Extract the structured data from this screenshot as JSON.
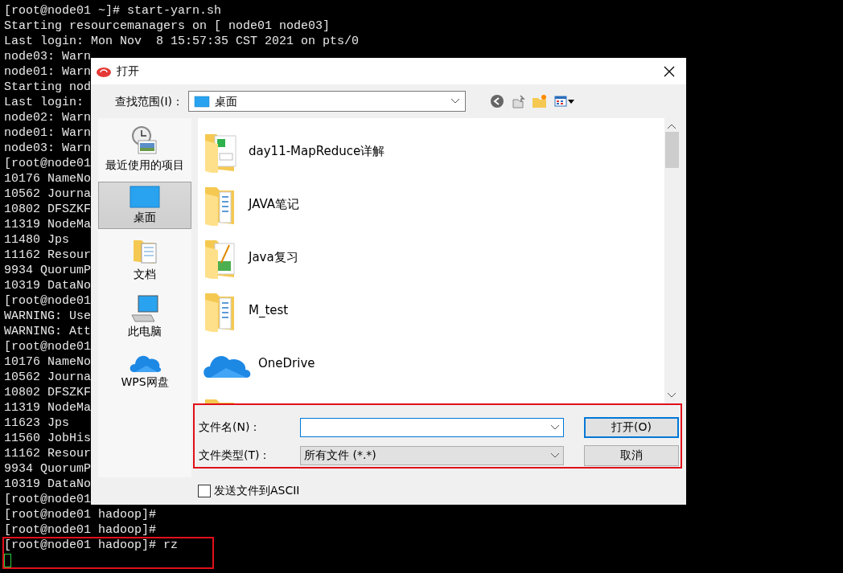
{
  "terminal": {
    "lines": [
      "[root@node01 ~]# start-yarn.sh",
      "Starting resourcemanagers on [ node01 node03]",
      "Last login: Mon Nov  8 15:57:35 CST 2021 on pts/0",
      "node03: Warn",
      "node01: Warn",
      "Starting nod",
      "Last login:",
      "node02: Warn",
      "node01: Warn",
      "node03: Warn",
      "[root@node01",
      "10176 NameNo",
      "10562 Journa",
      "10802 DFSZKF",
      "11319 NodeMa",
      "11480 Jps",
      "11162 Resour",
      "9934 QuorumP",
      "10319 DataNo",
      "[root@node01",
      "WARNING: Use",
      "WARNING: Att",
      "[root@node01",
      "10176 NameNo",
      "10562 Journa",
      "10802 DFSZKF",
      "11319 NodeMa",
      "11623 Jps",
      "11560 JobHis",
      "11162 Resour",
      "9934 QuorumP",
      "10319 DataNo",
      "[root@node01",
      "[root@node01 hadoop]#",
      "[root@node01 hadoop]#",
      "[root@node01 hadoop]# rz"
    ]
  },
  "dialog": {
    "title": "打开",
    "look_in": {
      "label": "查找范围(I)：",
      "value": "桌面"
    },
    "places": [
      {
        "kind": "recent",
        "label": "最近使用的项目",
        "selected": false
      },
      {
        "kind": "desktop",
        "label": "桌面",
        "selected": true
      },
      {
        "kind": "documents",
        "label": "文档",
        "selected": false
      },
      {
        "kind": "computer",
        "label": "此电脑",
        "selected": false
      },
      {
        "kind": "cloud",
        "label": "WPS网盘",
        "selected": false
      }
    ],
    "files": [
      {
        "kind": "sheet-folder",
        "name": "day11-MapReduce详解"
      },
      {
        "kind": "doc-folder",
        "name": "JAVA笔记"
      },
      {
        "kind": "image-folder",
        "name": "Java复习"
      },
      {
        "kind": "doc-folder",
        "name": "M_test"
      },
      {
        "kind": "cloud",
        "name": "OneDrive"
      },
      {
        "kind": "folder"
      }
    ],
    "file_name": {
      "label": "文件名(N)：",
      "focused": true
    },
    "file_type": {
      "label": "文件类型(T)：",
      "value": "所有文件 (*.*)"
    },
    "buttons": [
      {
        "label": "打开(O)",
        "default": true
      },
      {
        "label": "取消",
        "default": false
      }
    ],
    "ascii_checkbox": {
      "label": "发送文件到ASCII",
      "checked": false
    }
  }
}
